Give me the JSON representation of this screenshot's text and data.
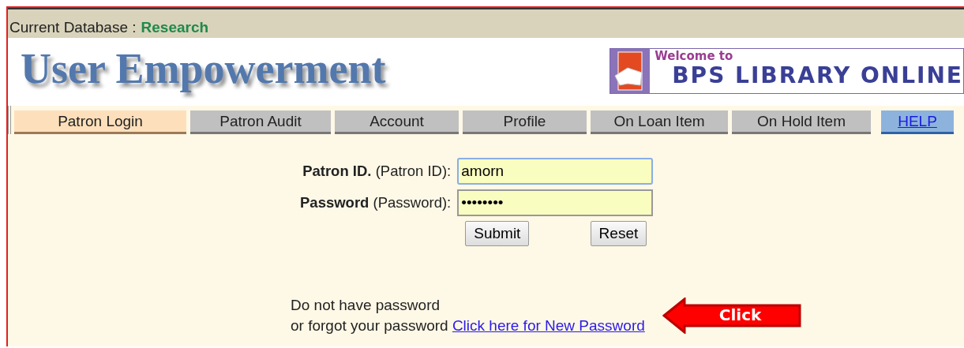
{
  "database": {
    "label": "Current Database :",
    "name": "Research"
  },
  "header": {
    "title": "User Empowerment",
    "banner": {
      "welcome": "Welcome to",
      "name": "BPS LIBRARY ONLINE"
    }
  },
  "tabs": [
    {
      "label": "Patron Login",
      "selected": true,
      "kind": "tab"
    },
    {
      "label": "Patron Audit",
      "selected": false,
      "kind": "tab"
    },
    {
      "label": "Account",
      "selected": false,
      "kind": "tab"
    },
    {
      "label": "Profile",
      "selected": false,
      "kind": "tab"
    },
    {
      "label": "On Loan Item",
      "selected": false,
      "kind": "tab"
    },
    {
      "label": "On Hold Item",
      "selected": false,
      "kind": "tab"
    },
    {
      "label": "HELP",
      "selected": false,
      "kind": "help"
    }
  ],
  "form": {
    "fields": [
      {
        "label": "Patron ID.",
        "hint": "(Patron ID):",
        "value": "amorn",
        "focused": true
      },
      {
        "label": "Password",
        "hint": "(Password):",
        "value": "••••••••",
        "focused": false
      }
    ],
    "buttons": [
      "Submit",
      "Reset"
    ]
  },
  "note": {
    "line1": "Do not have password",
    "line2": "or forgot your password",
    "link": "Click here for New Password"
  },
  "callout": {
    "label": "Click"
  }
}
